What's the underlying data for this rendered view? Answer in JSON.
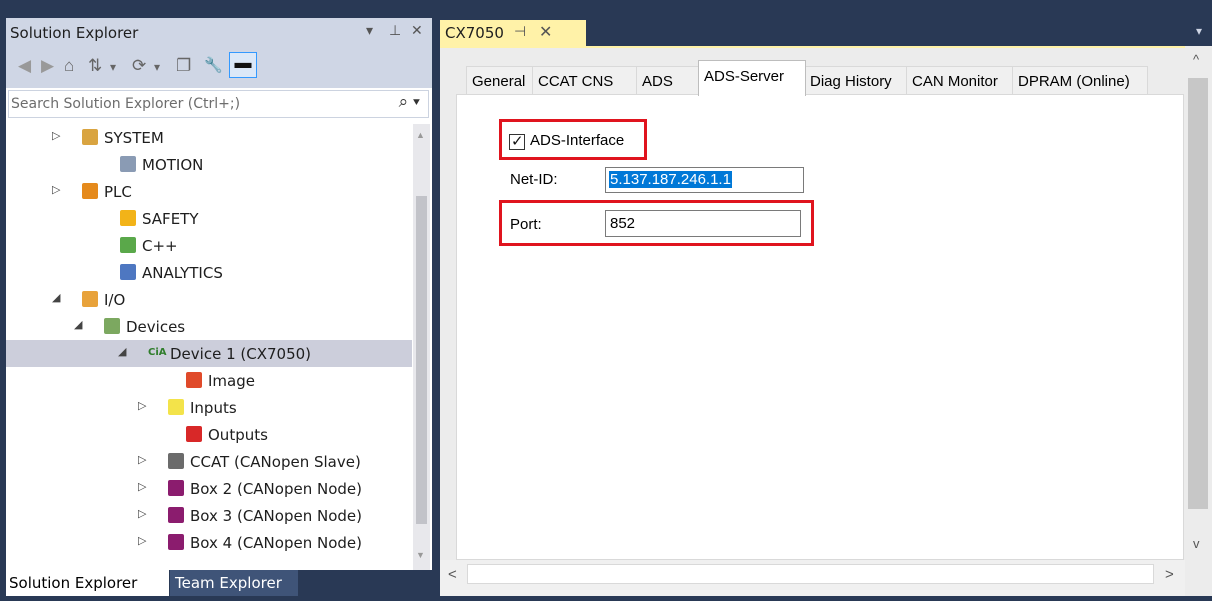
{
  "solution_explorer": {
    "title": "Solution Explorer",
    "title_glyphs": [
      "▾",
      "⊥",
      "✕"
    ],
    "toolbar_glyphs": [
      "◀",
      "▶",
      "⌂",
      "⇅",
      "▾",
      "⟳",
      "▾",
      "❐",
      "🔧",
      "▬"
    ],
    "search_placeholder": "Search Solution Explorer (Ctrl+;)",
    "search_icon": "⌕ ▾",
    "tree": [
      {
        "label": "SYSTEM",
        "icon": "system-icon",
        "color": "#d9a440",
        "expander": "▷"
      },
      {
        "label": "MOTION",
        "icon": "motion-icon",
        "color": "#8a9bb4",
        "expander": ""
      },
      {
        "label": "PLC",
        "icon": "plc-icon",
        "color": "#e58a1c",
        "expander": "▷"
      },
      {
        "label": "SAFETY",
        "icon": "safety-icon",
        "color": "#f2b318",
        "expander": ""
      },
      {
        "label": "C++",
        "icon": "cpp-icon",
        "color": "#5aa84a",
        "expander": ""
      },
      {
        "label": "ANALYTICS",
        "icon": "analytics-icon",
        "color": "#4e77c1",
        "expander": ""
      },
      {
        "label": "I/O",
        "icon": "io-icon",
        "color": "#e8a23a",
        "expander": "◢"
      },
      {
        "label": "Devices",
        "icon": "devices-icon",
        "color": "#7ca860",
        "expander": "◢"
      },
      {
        "label": "Device 1 (CX7050)",
        "icon": "cia-icon",
        "color": "#2f7d2b",
        "expander": "◢",
        "glyph": "CiA"
      },
      {
        "label": "Image",
        "icon": "image-icon",
        "color": "#e04a2a",
        "expander": ""
      },
      {
        "label": "Inputs",
        "icon": "inputs-icon",
        "color": "#f3e34a",
        "expander": "▷"
      },
      {
        "label": "Outputs",
        "icon": "outputs-icon",
        "color": "#d82828",
        "expander": ""
      },
      {
        "label": "CCAT (CANopen Slave)",
        "icon": "ccat-icon",
        "color": "#6b6b6b",
        "expander": "▷"
      },
      {
        "label": "Box 2 (CANopen Node)",
        "icon": "box-icon",
        "color": "#8b1c6e",
        "expander": "▷"
      },
      {
        "label": "Box 3 (CANopen Node)",
        "icon": "box-icon",
        "color": "#8b1c6e",
        "expander": "▷"
      },
      {
        "label": "Box 4 (CANopen Node)",
        "icon": "box-icon",
        "color": "#8b1c6e",
        "expander": "▷"
      }
    ],
    "selected_index": 8,
    "bottom_tabs": [
      "Solution Explorer",
      "Team Explorer"
    ]
  },
  "document": {
    "tab_title": "CX7050",
    "pin_glyph": "⊣",
    "close_glyph": "✕",
    "dropdown_glyph": "▾",
    "tabs": [
      "General",
      "CCAT CNS",
      "ADS",
      "ADS-Server",
      "Diag History",
      "CAN Monitor",
      "DPRAM (Online)"
    ],
    "active_tab": "ADS-Server",
    "scroll_glyphs": {
      "up": "^",
      "down": "v",
      "left": "<",
      "right": ">"
    },
    "form": {
      "checkbox_label": "ADS-Interface",
      "checkbox_checked": true,
      "checkmark": "✓",
      "netid_label": "Net-ID:",
      "netid_value": "5.137.187.246.1.1",
      "port_label": "Port:",
      "port_value": "852"
    }
  },
  "colors": {
    "frame": "#293955",
    "tab_active": "#fff2a8",
    "highlight": "#e0141e",
    "selection": "#0078d7"
  }
}
